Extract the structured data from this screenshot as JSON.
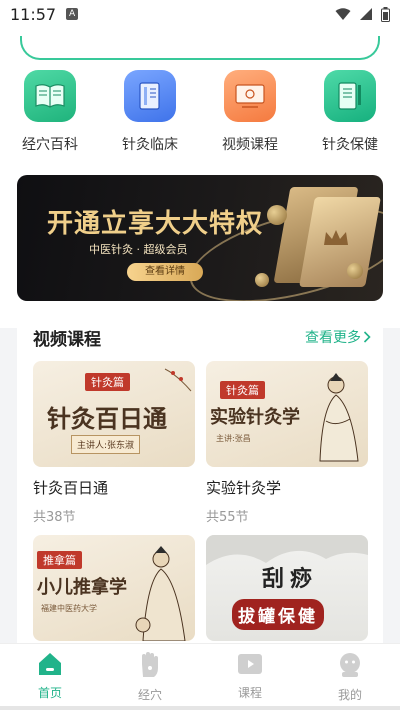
{
  "status_bar": {
    "time": "11:57",
    "badge": "A"
  },
  "quick_nav": [
    {
      "label": "经穴百科",
      "icon": "book-icon",
      "color": "#31c58f"
    },
    {
      "label": "针灸临床",
      "icon": "document-icon",
      "color": "#4f8af5"
    },
    {
      "label": "视频课程",
      "icon": "video-icon",
      "color": "#fa8a52"
    },
    {
      "label": "针灸保健",
      "icon": "notebook-icon",
      "color": "#20c08a"
    }
  ],
  "banner": {
    "title": "开通立享大大特权",
    "subtitle": "中医针灸 · 超级会员",
    "button": "查看详情"
  },
  "video_section": {
    "title": "视频课程",
    "more": "查看更多",
    "courses": [
      {
        "name": "针灸百日通",
        "count": "共38节",
        "tag": "针灸篇",
        "big": "针灸百日通",
        "small": "主讲人:张东淑"
      },
      {
        "name": "实验针灸学",
        "count": "共55节",
        "tag": "针灸篇",
        "big": "实验针灸学",
        "small": "主讲:张昌"
      },
      {
        "name": "",
        "count": "",
        "tag": "推拿篇",
        "big": "小儿推拿学",
        "small": "福建中医药大学"
      },
      {
        "name": "",
        "count": "",
        "tag": "",
        "big": "刮痧",
        "small": "拔罐保健"
      }
    ]
  },
  "tab_bar": [
    {
      "label": "首页",
      "icon": "home-icon",
      "active": true
    },
    {
      "label": "经穴",
      "icon": "hand-acupoint-icon",
      "active": false
    },
    {
      "label": "课程",
      "icon": "course-video-icon",
      "active": false
    },
    {
      "label": "我的",
      "icon": "profile-icon",
      "active": false
    }
  ]
}
